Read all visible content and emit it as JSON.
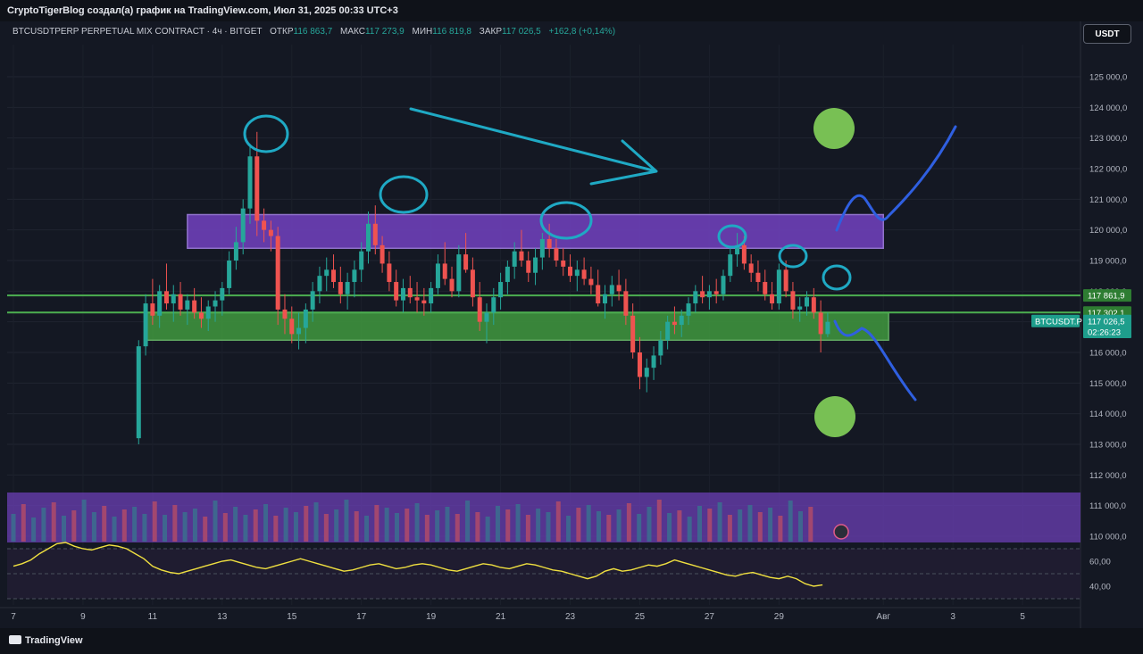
{
  "header": {
    "title": "CryptoTigerBlog создал(а) график на TradingView.com, Июл 31, 2025 00:33 UTC+3"
  },
  "legend": {
    "symbol": "BTCUSDTPERP PERPETUAL MIX CONTRACT · 4ч · BITGET",
    "open_label": "ОТКР",
    "open": "116 863,7",
    "high_label": "МАКС",
    "high": "117 273,9",
    "low_label": "МИН",
    "low": "116 819,8",
    "close_label": "ЗАКР",
    "close": "117 026,5",
    "change": "+162,8 (+0,14%)"
  },
  "currency_button": "USDT",
  "footer": {
    "brand": "TradingView"
  },
  "colors": {
    "up": "#26a69a",
    "down": "#ef5350",
    "bg": "#141823",
    "resistance_zone": "#6b3fb5",
    "support_zone": "#3d8f3d",
    "annotation": "#1fa9c4",
    "projection": "#2f5fe0",
    "target_dot": "#78c054",
    "rsi_line": "#f0e040"
  },
  "chart_data": {
    "type": "candlestick",
    "title": "BTCUSDTPERP PERPETUAL MIX CONTRACT · 4ч · BITGET",
    "y_ticks": [
      125000,
      124000,
      123000,
      122000,
      121000,
      120000,
      119000,
      118000,
      117000,
      116000,
      115000,
      114000,
      113000,
      112000,
      111000,
      110000
    ],
    "y_tick_labels": [
      "125 000,0",
      "124 000,0",
      "123 000,0",
      "122 000,0",
      "121 000,0",
      "120 000,0",
      "119 000,0",
      "118 000,0",
      "117 000,0",
      "116 000,0",
      "115 000,0",
      "114 000,0",
      "113 000,0",
      "112 000,0",
      "111 000,0",
      "110 000,0"
    ],
    "ylim": [
      109950,
      126200
    ],
    "x_tick_labels": [
      "7",
      "9",
      "11",
      "13",
      "15",
      "17",
      "19",
      "21",
      "23",
      "25",
      "27",
      "29",
      "Авг",
      "3",
      "5"
    ],
    "x_tick_days": [
      7,
      9,
      11,
      13,
      15,
      17,
      19,
      21,
      23,
      25,
      27,
      29,
      32,
      34,
      36
    ],
    "xlim_days": [
      7,
      38.1
    ],
    "price_labels": [
      {
        "label": "117 861,9",
        "value": 117861.9,
        "kind": "line"
      },
      {
        "label": "117 302,1",
        "value": 117302.1,
        "kind": "line"
      },
      {
        "label": "117 026,5",
        "value": 117026.5,
        "kind": "last"
      },
      {
        "label": "02:26:23",
        "value": 116650,
        "kind": "timer"
      }
    ],
    "symbol_tag": "BTCUSDT.P",
    "horizontal_lines": [
      117861.9,
      117302.1
    ],
    "zones": [
      {
        "name": "resistance",
        "from_day": 12,
        "to_day": 32,
        "low": 119400,
        "high": 120500
      },
      {
        "name": "support",
        "from_day": 10.8,
        "to_day": 32.15,
        "low": 116400,
        "high": 117300
      }
    ],
    "series": [
      {
        "name": "Price",
        "candles": [
          [
            10.6,
            113200,
            116400,
            113000,
            116200
          ],
          [
            10.8,
            116200,
            117900,
            115900,
            117600
          ],
          [
            11.0,
            117600,
            118400,
            116900,
            117200
          ],
          [
            11.2,
            117200,
            118200,
            116800,
            118000
          ],
          [
            11.4,
            118000,
            118900,
            117400,
            117600
          ],
          [
            11.6,
            117600,
            118200,
            117000,
            117900
          ],
          [
            11.8,
            117900,
            118300,
            117200,
            117400
          ],
          [
            12.0,
            117400,
            117900,
            116900,
            117700
          ],
          [
            12.2,
            117700,
            118100,
            117100,
            117300
          ],
          [
            12.4,
            117300,
            117800,
            116800,
            117100
          ],
          [
            12.6,
            117100,
            117700,
            116700,
            117500
          ],
          [
            12.8,
            117500,
            118000,
            117000,
            117700
          ],
          [
            13.0,
            117700,
            118300,
            117200,
            118100
          ],
          [
            13.2,
            118100,
            119300,
            117900,
            119000
          ],
          [
            13.4,
            119000,
            120100,
            118700,
            119600
          ],
          [
            13.6,
            119600,
            121000,
            119200,
            120700
          ],
          [
            13.8,
            120700,
            122800,
            120200,
            122400
          ],
          [
            14.0,
            122400,
            123200,
            119800,
            120300
          ],
          [
            14.2,
            120300,
            120700,
            119600,
            120000
          ],
          [
            14.4,
            120000,
            120300,
            119300,
            119800
          ],
          [
            14.6,
            119800,
            120100,
            116900,
            117400
          ],
          [
            14.8,
            117400,
            117900,
            116600,
            117100
          ],
          [
            15.0,
            117100,
            117500,
            116300,
            116600
          ],
          [
            15.2,
            116600,
            117300,
            116100,
            116800
          ],
          [
            15.4,
            116800,
            117600,
            116300,
            117400
          ],
          [
            15.6,
            117400,
            118300,
            117000,
            118000
          ],
          [
            15.8,
            118000,
            118800,
            117600,
            118500
          ],
          [
            16.0,
            118500,
            119100,
            118000,
            118700
          ],
          [
            16.2,
            118700,
            119200,
            118100,
            118300
          ],
          [
            16.4,
            118300,
            118800,
            117600,
            117900
          ],
          [
            16.6,
            117900,
            118600,
            117400,
            118300
          ],
          [
            16.8,
            118300,
            119000,
            117800,
            118700
          ],
          [
            17.0,
            118700,
            119600,
            118300,
            119300
          ],
          [
            17.2,
            119300,
            120600,
            118900,
            120200
          ],
          [
            17.4,
            120200,
            120800,
            119200,
            119500
          ],
          [
            17.6,
            119500,
            119800,
            118600,
            118900
          ],
          [
            17.8,
            118900,
            119300,
            118000,
            118300
          ],
          [
            18.0,
            118300,
            118700,
            117500,
            117700
          ],
          [
            18.2,
            117700,
            118400,
            117300,
            118100
          ],
          [
            18.4,
            118100,
            118500,
            117600,
            117800
          ],
          [
            18.6,
            117800,
            118300,
            117300,
            117700
          ],
          [
            18.8,
            117700,
            118100,
            117200,
            117600
          ],
          [
            19.0,
            117600,
            118300,
            117300,
            118100
          ],
          [
            19.2,
            118100,
            119200,
            117900,
            118900
          ],
          [
            19.4,
            118900,
            119600,
            118200,
            118400
          ],
          [
            19.6,
            118400,
            118800,
            117800,
            118000
          ],
          [
            19.8,
            118000,
            119500,
            117800,
            119200
          ],
          [
            20.0,
            119200,
            119900,
            118600,
            118700
          ],
          [
            20.2,
            118700,
            119100,
            117500,
            117800
          ],
          [
            20.4,
            117800,
            118300,
            116700,
            117000
          ],
          [
            20.6,
            117000,
            117600,
            116300,
            117300
          ],
          [
            20.8,
            117300,
            118100,
            116900,
            117800
          ],
          [
            21.0,
            117800,
            118600,
            117400,
            118300
          ],
          [
            21.2,
            118300,
            119000,
            117900,
            118800
          ],
          [
            21.4,
            118800,
            119600,
            118400,
            119300
          ],
          [
            21.6,
            119300,
            120000,
            118800,
            119000
          ],
          [
            21.8,
            119000,
            119300,
            118300,
            118600
          ],
          [
            22.0,
            118600,
            119400,
            118200,
            119100
          ],
          [
            22.2,
            119100,
            119900,
            118700,
            119700
          ],
          [
            22.4,
            119700,
            120200,
            119100,
            119400
          ],
          [
            22.6,
            119400,
            119700,
            118800,
            119000
          ],
          [
            22.8,
            119000,
            119400,
            118500,
            118800
          ],
          [
            23.0,
            118800,
            119200,
            118300,
            118500
          ],
          [
            23.2,
            118500,
            119000,
            118000,
            118700
          ],
          [
            23.4,
            118700,
            119100,
            118200,
            118400
          ],
          [
            23.6,
            118400,
            118800,
            117900,
            118200
          ],
          [
            23.8,
            118200,
            118700,
            117500,
            117600
          ],
          [
            24.0,
            117600,
            118200,
            117100,
            117900
          ],
          [
            24.2,
            117900,
            118500,
            117500,
            118200
          ],
          [
            24.4,
            118200,
            118700,
            117700,
            118000
          ],
          [
            24.6,
            118000,
            118400,
            116900,
            117200
          ],
          [
            24.8,
            117200,
            117600,
            115800,
            116000
          ],
          [
            25.0,
            116000,
            116500,
            114800,
            115200
          ],
          [
            25.2,
            115200,
            115800,
            114700,
            115500
          ],
          [
            25.4,
            115500,
            116200,
            115100,
            115900
          ],
          [
            25.6,
            115900,
            116700,
            115600,
            116400
          ],
          [
            25.8,
            116400,
            117200,
            116100,
            117000
          ],
          [
            26.0,
            117000,
            117500,
            116600,
            116900
          ],
          [
            26.2,
            116900,
            117400,
            116500,
            117200
          ],
          [
            26.4,
            117200,
            117800,
            116900,
            117600
          ],
          [
            26.6,
            117600,
            118200,
            117300,
            118000
          ],
          [
            26.8,
            118000,
            118500,
            117600,
            117800
          ],
          [
            27.0,
            117800,
            118200,
            117400,
            118000
          ],
          [
            27.2,
            118000,
            118400,
            117600,
            117900
          ],
          [
            27.4,
            117900,
            118700,
            117700,
            118500
          ],
          [
            27.6,
            118500,
            119400,
            118300,
            119200
          ],
          [
            27.8,
            119200,
            119900,
            118800,
            119500
          ],
          [
            28.0,
            119500,
            119800,
            118700,
            118900
          ],
          [
            28.2,
            118900,
            119200,
            118300,
            118600
          ],
          [
            28.4,
            118600,
            119000,
            118000,
            118300
          ],
          [
            28.6,
            118300,
            118700,
            117700,
            117900
          ],
          [
            28.8,
            117900,
            118300,
            117400,
            117600
          ],
          [
            29.0,
            117600,
            118900,
            117400,
            118700
          ],
          [
            29.2,
            118700,
            119000,
            117800,
            118000
          ],
          [
            29.4,
            118000,
            118300,
            117100,
            117400
          ],
          [
            29.6,
            117400,
            117800,
            117000,
            117500
          ],
          [
            29.8,
            117500,
            118000,
            117200,
            117800
          ],
          [
            30.0,
            117800,
            118100,
            117100,
            117300
          ],
          [
            30.2,
            117300,
            117700,
            116000,
            116600
          ],
          [
            30.4,
            116600,
            117300,
            116500,
            117000
          ]
        ]
      },
      {
        "name": "RSI",
        "values": [
          56,
          58,
          61,
          66,
          70,
          74,
          75,
          72,
          70,
          69,
          71,
          73,
          72,
          70,
          66,
          62,
          56,
          53,
          51,
          50,
          52,
          54,
          56,
          58,
          60,
          61,
          59,
          57,
          55,
          54,
          56,
          58,
          60,
          62,
          60,
          58,
          56,
          54,
          52,
          53,
          55,
          57,
          58,
          56,
          54,
          55,
          57,
          58,
          57,
          55,
          53,
          52,
          54,
          56,
          58,
          57,
          55,
          54,
          56,
          58,
          57,
          55,
          53,
          52,
          50,
          48,
          46,
          48,
          52,
          54,
          52,
          53,
          55,
          57,
          56,
          58,
          61,
          59,
          57,
          55,
          53,
          51,
          49,
          48,
          50,
          51,
          49,
          47,
          46,
          48,
          46,
          42,
          40,
          41
        ]
      },
      {
        "name": "Volume",
        "values": [
          31,
          42,
          27,
          38,
          44,
          29,
          35,
          47,
          33,
          40,
          28,
          36,
          39,
          31,
          45,
          30,
          41,
          33,
          37,
          28,
          46,
          32,
          39,
          30,
          36,
          42,
          29,
          38,
          33,
          40,
          44,
          31,
          36,
          47,
          34,
          29,
          41,
          38,
          32,
          37,
          43,
          30,
          35,
          39,
          31,
          46,
          33,
          28,
          40,
          36,
          42,
          30,
          37,
          33,
          45,
          29,
          38,
          41,
          34,
          30,
          36,
          43,
          31,
          39,
          47,
          32,
          35,
          28,
          40,
          37,
          44,
          30,
          36,
          41,
          33,
          38,
          29,
          46,
          34,
          39
        ]
      }
    ],
    "rsi_levels": [
      70,
      50,
      30
    ],
    "rsi_tick_labels": [
      "60,00",
      "40,00"
    ],
    "grid": true
  }
}
